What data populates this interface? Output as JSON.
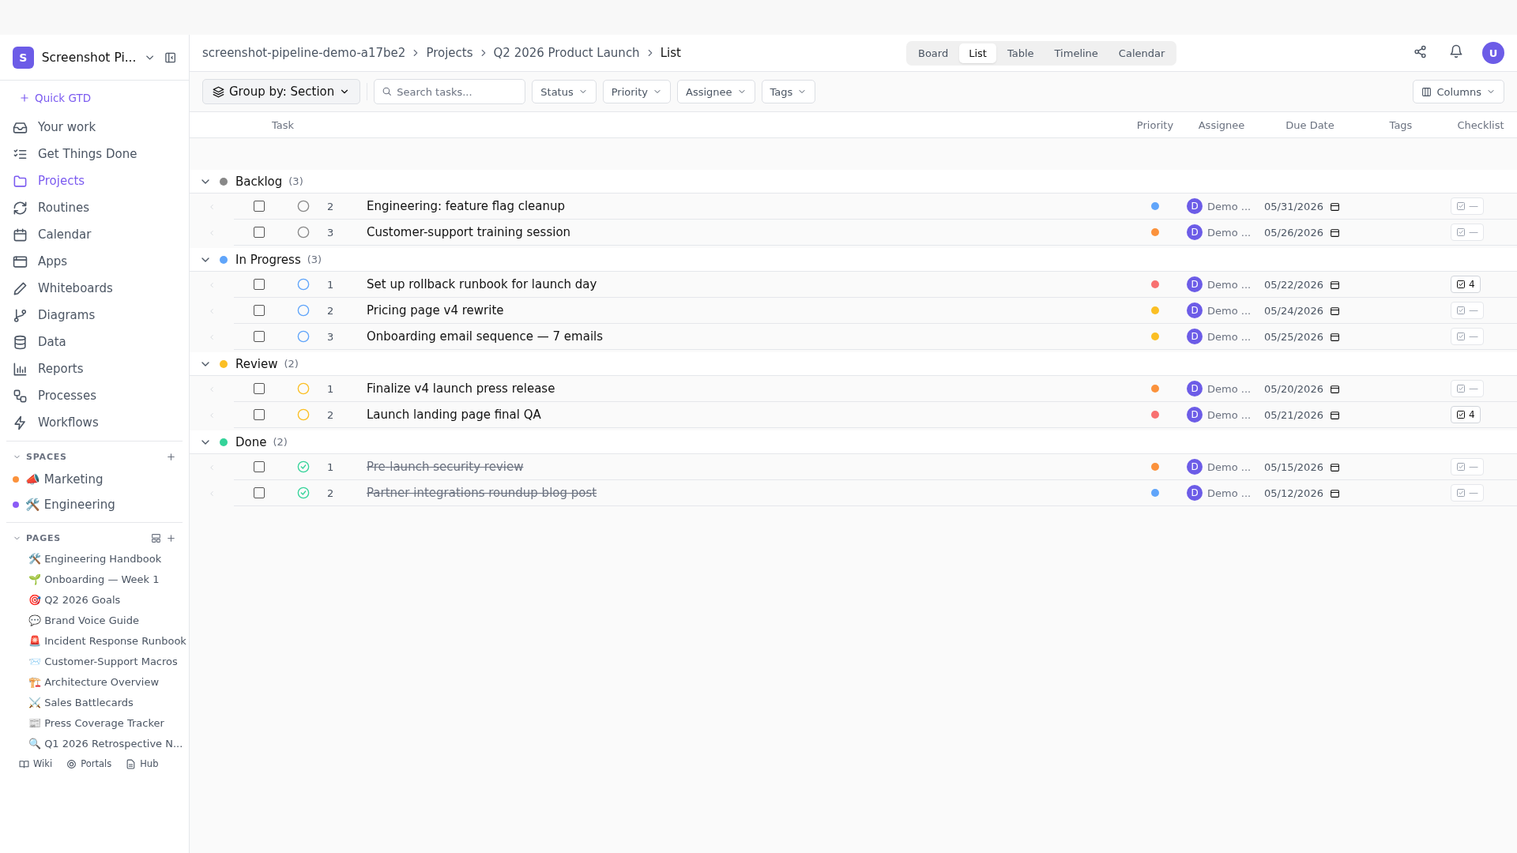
{
  "sidebar": {
    "workspace": {
      "initial": "S",
      "name": "Screenshot Pi..."
    },
    "quick_action": "Quick GTD",
    "nav": [
      {
        "label": "Your work",
        "selected": false
      },
      {
        "label": "Get Things Done",
        "selected": false
      },
      {
        "label": "Projects",
        "selected": true
      },
      {
        "label": "Routines",
        "selected": false
      },
      {
        "label": "Calendar",
        "selected": false
      },
      {
        "label": "Apps",
        "selected": false
      },
      {
        "label": "Whiteboards",
        "selected": false
      },
      {
        "label": "Diagrams",
        "selected": false
      },
      {
        "label": "Data",
        "selected": false
      },
      {
        "label": "Reports",
        "selected": false
      },
      {
        "label": "Processes",
        "selected": false
      },
      {
        "label": "Workflows",
        "selected": false
      }
    ],
    "spaces": {
      "title": "SPACES",
      "items": [
        {
          "label": "📣 Marketing",
          "color": "#fb923c"
        },
        {
          "label": "🛠️ Engineering",
          "color": "#8b5cf6"
        }
      ]
    },
    "pages": {
      "title": "PAGES",
      "items": [
        "🛠️ Engineering Handbook",
        "🌱 Onboarding — Week 1",
        "🎯 Q2 2026 Goals",
        "💬 Brand Voice Guide",
        "🚨 Incident Response Runbook",
        "📨 Customer-Support Macros",
        "🏗️ Architecture Overview",
        "⚔️ Sales Battlecards",
        "📰 Press Coverage Tracker",
        "🔍 Q1 2026 Retrospective N..."
      ]
    },
    "footer": [
      "Wiki",
      "Portals",
      "Hub"
    ]
  },
  "header": {
    "breadcrumbs": [
      "screenshot-pipeline-demo-a17be2",
      "Projects",
      "Q2 2026 Product Launch",
      "List"
    ],
    "views": [
      {
        "label": "Board",
        "selected": false
      },
      {
        "label": "List",
        "selected": true
      },
      {
        "label": "Table",
        "selected": false
      },
      {
        "label": "Timeline",
        "selected": false
      },
      {
        "label": "Calendar",
        "selected": false
      }
    ],
    "user_initial": "U"
  },
  "toolbar": {
    "group_by": "Group by: Section",
    "search": {
      "placeholder": "Search tasks..."
    },
    "filters": [
      "Status",
      "Priority",
      "Assignee",
      "Tags"
    ],
    "columns_button": "Columns"
  },
  "table": {
    "columns": [
      "Task",
      "Priority",
      "Assignee",
      "Due Date",
      "Tags",
      "Checklist"
    ],
    "groups": [
      {
        "name": "Backlog",
        "count": "(3)",
        "color": "#888888",
        "tasks": [
          {
            "number": "2",
            "title": "Engineering: feature flag cleanup",
            "done": false,
            "checked": false,
            "priority": {
              "color": "#60a5fa"
            },
            "assignee": {
              "initial": "D",
              "name": "Demo ..."
            },
            "due": "05/31/2026",
            "checklist": {
              "text": "—",
              "active": false
            }
          },
          {
            "number": "3",
            "title": "Customer-support training session",
            "done": false,
            "checked": false,
            "priority": {
              "color": "#fb923c"
            },
            "assignee": {
              "initial": "D",
              "name": "Demo ..."
            },
            "due": "05/26/2026",
            "checklist": {
              "text": "—",
              "active": false
            }
          }
        ]
      },
      {
        "name": "In Progress",
        "count": "(3)",
        "color": "#60a5fa",
        "tasks": [
          {
            "number": "1",
            "title": "Set up rollback runbook for launch day",
            "done": false,
            "checked": false,
            "priority": {
              "color": "#f87171"
            },
            "assignee": {
              "initial": "D",
              "name": "Demo ..."
            },
            "due": "05/22/2026",
            "checklist": {
              "text": "4",
              "active": true
            }
          },
          {
            "number": "2",
            "title": "Pricing page v4 rewrite",
            "done": false,
            "checked": false,
            "priority": {
              "color": "#fbbf24"
            },
            "assignee": {
              "initial": "D",
              "name": "Demo ..."
            },
            "due": "05/24/2026",
            "checklist": {
              "text": "—",
              "active": false
            }
          },
          {
            "number": "3",
            "title": "Onboarding email sequence — 7 emails",
            "done": false,
            "checked": false,
            "priority": {
              "color": "#fbbf24"
            },
            "assignee": {
              "initial": "D",
              "name": "Demo ..."
            },
            "due": "05/25/2026",
            "checklist": {
              "text": "—",
              "active": false
            }
          }
        ]
      },
      {
        "name": "Review",
        "count": "(2)",
        "color": "#fbbf24",
        "tasks": [
          {
            "number": "1",
            "title": "Finalize v4 launch press release",
            "done": false,
            "checked": false,
            "priority": {
              "color": "#fb923c"
            },
            "assignee": {
              "initial": "D",
              "name": "Demo ..."
            },
            "due": "05/20/2026",
            "checklist": {
              "text": "—",
              "active": false
            }
          },
          {
            "number": "2",
            "title": "Launch landing page final QA",
            "done": false,
            "checked": false,
            "priority": {
              "color": "#f87171"
            },
            "assignee": {
              "initial": "D",
              "name": "Demo ..."
            },
            "due": "05/21/2026",
            "checklist": {
              "text": "4",
              "active": true
            }
          }
        ]
      },
      {
        "name": "Done",
        "count": "(2)",
        "color": "#34d399",
        "tasks": [
          {
            "number": "1",
            "title": "Pre-launch security review",
            "done": true,
            "checked": false,
            "priority": {
              "color": "#fb923c"
            },
            "assignee": {
              "initial": "D",
              "name": "Demo ..."
            },
            "due": "05/15/2026",
            "checklist": {
              "text": "—",
              "active": false
            }
          },
          {
            "number": "2",
            "title": "Partner integrations roundup blog post",
            "done": true,
            "checked": false,
            "priority": {
              "color": "#60a5fa"
            },
            "assignee": {
              "initial": "D",
              "name": "Demo ..."
            },
            "due": "05/12/2026",
            "checklist": {
              "text": "—",
              "active": false
            }
          }
        ]
      }
    ]
  }
}
